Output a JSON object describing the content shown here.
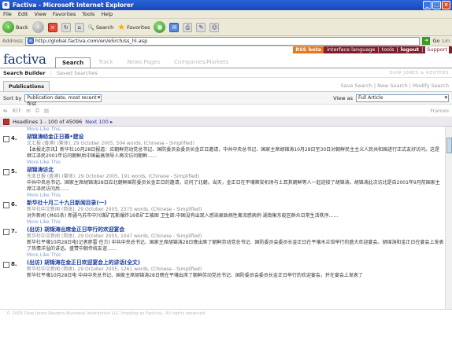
{
  "window": {
    "title": "Factiva - Microsoft Internet Explorer"
  },
  "menu": [
    "File",
    "Edit",
    "View",
    "Favorites",
    "Tools",
    "Help"
  ],
  "toolbar": {
    "back": "Back",
    "search": "Search",
    "favorites": "Favorites"
  },
  "address": {
    "label": "Address",
    "url": "http://global.factiva.com/en/eSrch/ss_hl.asp",
    "go": "Go",
    "links": "Lin"
  },
  "header": {
    "logo": "factiva",
    "tabs": [
      "Search",
      "Track",
      "News Pages",
      "Companies/Markets"
    ],
    "rss_beta": "RSS beta",
    "top_links": [
      "interface language",
      "tools",
      "logout"
    ],
    "support": "Support"
  },
  "subheader": {
    "search_builder": "Search Builder",
    "saved_searches": "Saved Searches",
    "brand": "DOW JONES & REUTERS"
  },
  "publications": {
    "tab": "Publications",
    "links": "Save Search | New Search | Modify Search"
  },
  "sort": {
    "label": "Sort by",
    "value": "Publication date, most recent first"
  },
  "view": {
    "label": "View as",
    "value": "Full Article"
  },
  "actions": {
    "rtf": "RTF",
    "frames": "Frames"
  },
  "headlines": {
    "text": "Headlines 1 - 100 of 45096",
    "next": "Next 100 ▸"
  },
  "more_like": "More Like This",
  "results": [
    {
      "num": "4.",
      "title": "胡锦涛经金正日赛•建设",
      "meta": "文汇报 (香港) (繁体), 29 October 2005, 504 words, (Chinese - Simplified)",
      "snippet": "【本报北京讯】新华社10月28日报道：应朝鲜劳动党总书记、国防委员会委员长金正日邀请，中共中央总书记、国家主席胡锦涛10月28日至30日对朝鲜民主主义人民共和国进行正式友好访问。这是继江泽民2001年访问朝鲜后中国最高领导人再次访问朝鲜……"
    },
    {
      "num": "5.",
      "title": "胡锦涛访北",
      "meta": "东亚日报 (香港) (繁体), 29 October 2005, 191 words, (Chinese - Simplified)",
      "snippet": "中共中央总书记、国家主席胡锦涛28日应北朝鲜国防委员长金正日的邀请，访问了北朝。当天，金正日在平壤顺安机场与土耳其朝鲜等人一起迎接了胡锦涛。胡锦涛此次访北是自2001年9月前国家主席江泽民访问后……"
    },
    {
      "num": "6.",
      "title": "新华社十月二十九日新闻目录(一)",
      "meta": "新华社中文新闻 (简体), 29 October 2005, 2375 words, (Chinese - Simplified)",
      "snippet": "对外新闻 (共65条) 新疆乌苏市中兴煤矿瓦斯爆炸16名矿工被困 卫生部:中国没有出现人感染高致病性禽流感病例 湖南衡东疫区群众日常生活秩序……"
    },
    {
      "num": "7.",
      "title": "(出访) 胡锦涛出席金正日举行的欢迎宴会",
      "meta": "新华社中文新闻 (简体), 29 October 2005, 1047 words, (Chinese - Simplified)",
      "snippet": "新华社平壤10月28日电(记者廖雷 任方) 中共中央总书记、国家主席胡锦涛28日晚出席了朝鲜劳动党总书记、国防委员会委员长金正日在平壤木兰馆举行的盛大欢迎宴会。胡锦涛和金正日在宴会上发表了热情洋溢的讲话。盛赞中朝传统友谊……"
    },
    {
      "num": "8.",
      "title": "(出访) 胡锦涛在金正日欢迎宴会上的讲话(全文)",
      "meta": "新华社中文新闻 (简体), 29 October 2005, 1261 words, (Chinese - Simplified)",
      "snippet": "新华社平壤10月28日电 中共中央总书记、国家主席胡锦涛28日晚在平壤出席了朝鲜劳动党总书记、国防委员会委员长金正日举行的欢迎宴会，并在宴会上发表了"
    }
  ],
  "footer": "© 2005 Dow Jones Reuters Business Interactive LLC (trading as Factiva). All rights reserved."
}
